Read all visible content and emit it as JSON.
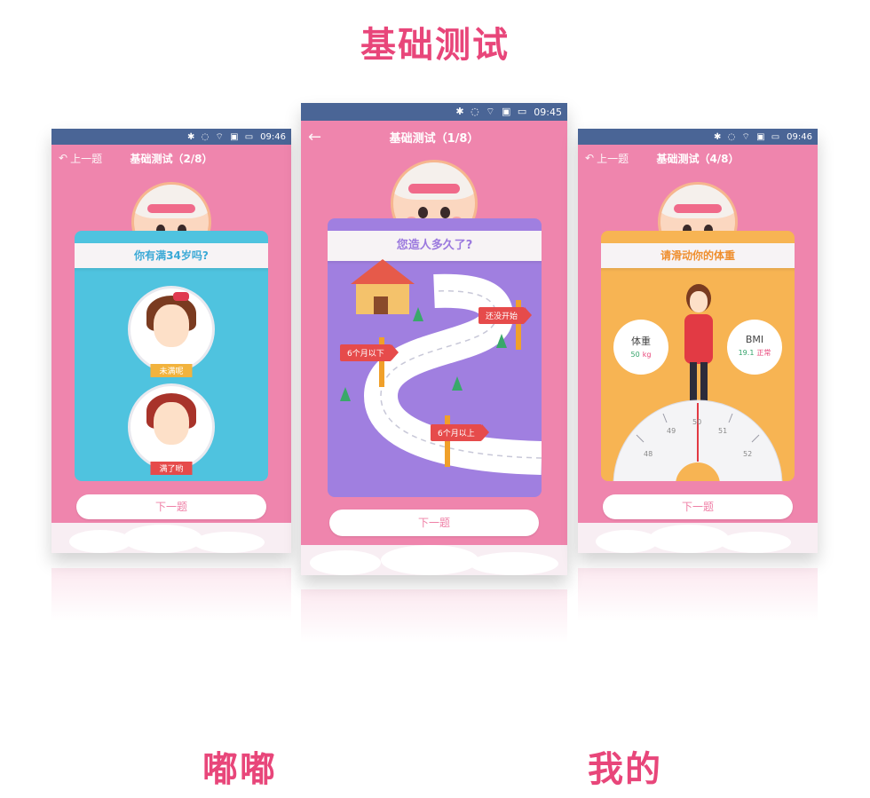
{
  "heading": "基础测试",
  "captions": {
    "left": "嘟嘟",
    "right": "我的"
  },
  "phones": {
    "left": {
      "time": "09:46",
      "back_label": "上一题",
      "title": "基础测试（2/8）",
      "question": "你有满34岁吗?",
      "options": [
        "未满呢",
        "满了哟"
      ],
      "next_label": "下一题"
    },
    "middle": {
      "time": "09:45",
      "title": "基础测试（1/8）",
      "question": "您造人多久了?",
      "signs": [
        "还没开始",
        "6个月以下",
        "6个月以上"
      ],
      "next_label": "下一题"
    },
    "right": {
      "time": "09:46",
      "back_label": "上一题",
      "title": "基础测试（4/8）",
      "question": "请滑动你的体重",
      "weight": {
        "label": "体重",
        "value": "50",
        "unit": "kg"
      },
      "bmi": {
        "label": "BMI",
        "value": "19.1",
        "status": "正常"
      },
      "scale_ticks": [
        "48",
        "49",
        "50",
        "51",
        "52"
      ],
      "next_label": "下一题"
    }
  },
  "colors": {
    "accent": "#e8467a",
    "phone_bg": "#ef85ad",
    "status_bar": "#4a6596",
    "card_blue": "#4fc3df",
    "card_purple": "#a07fe0",
    "card_orange": "#f7b453"
  },
  "icons": {
    "status": [
      "bluetooth-icon",
      "mute-icon",
      "wifi-icon",
      "sim-icon",
      "battery-icon"
    ],
    "back": "undo-arrow-icon",
    "middle_back": "left-arrow-icon"
  }
}
